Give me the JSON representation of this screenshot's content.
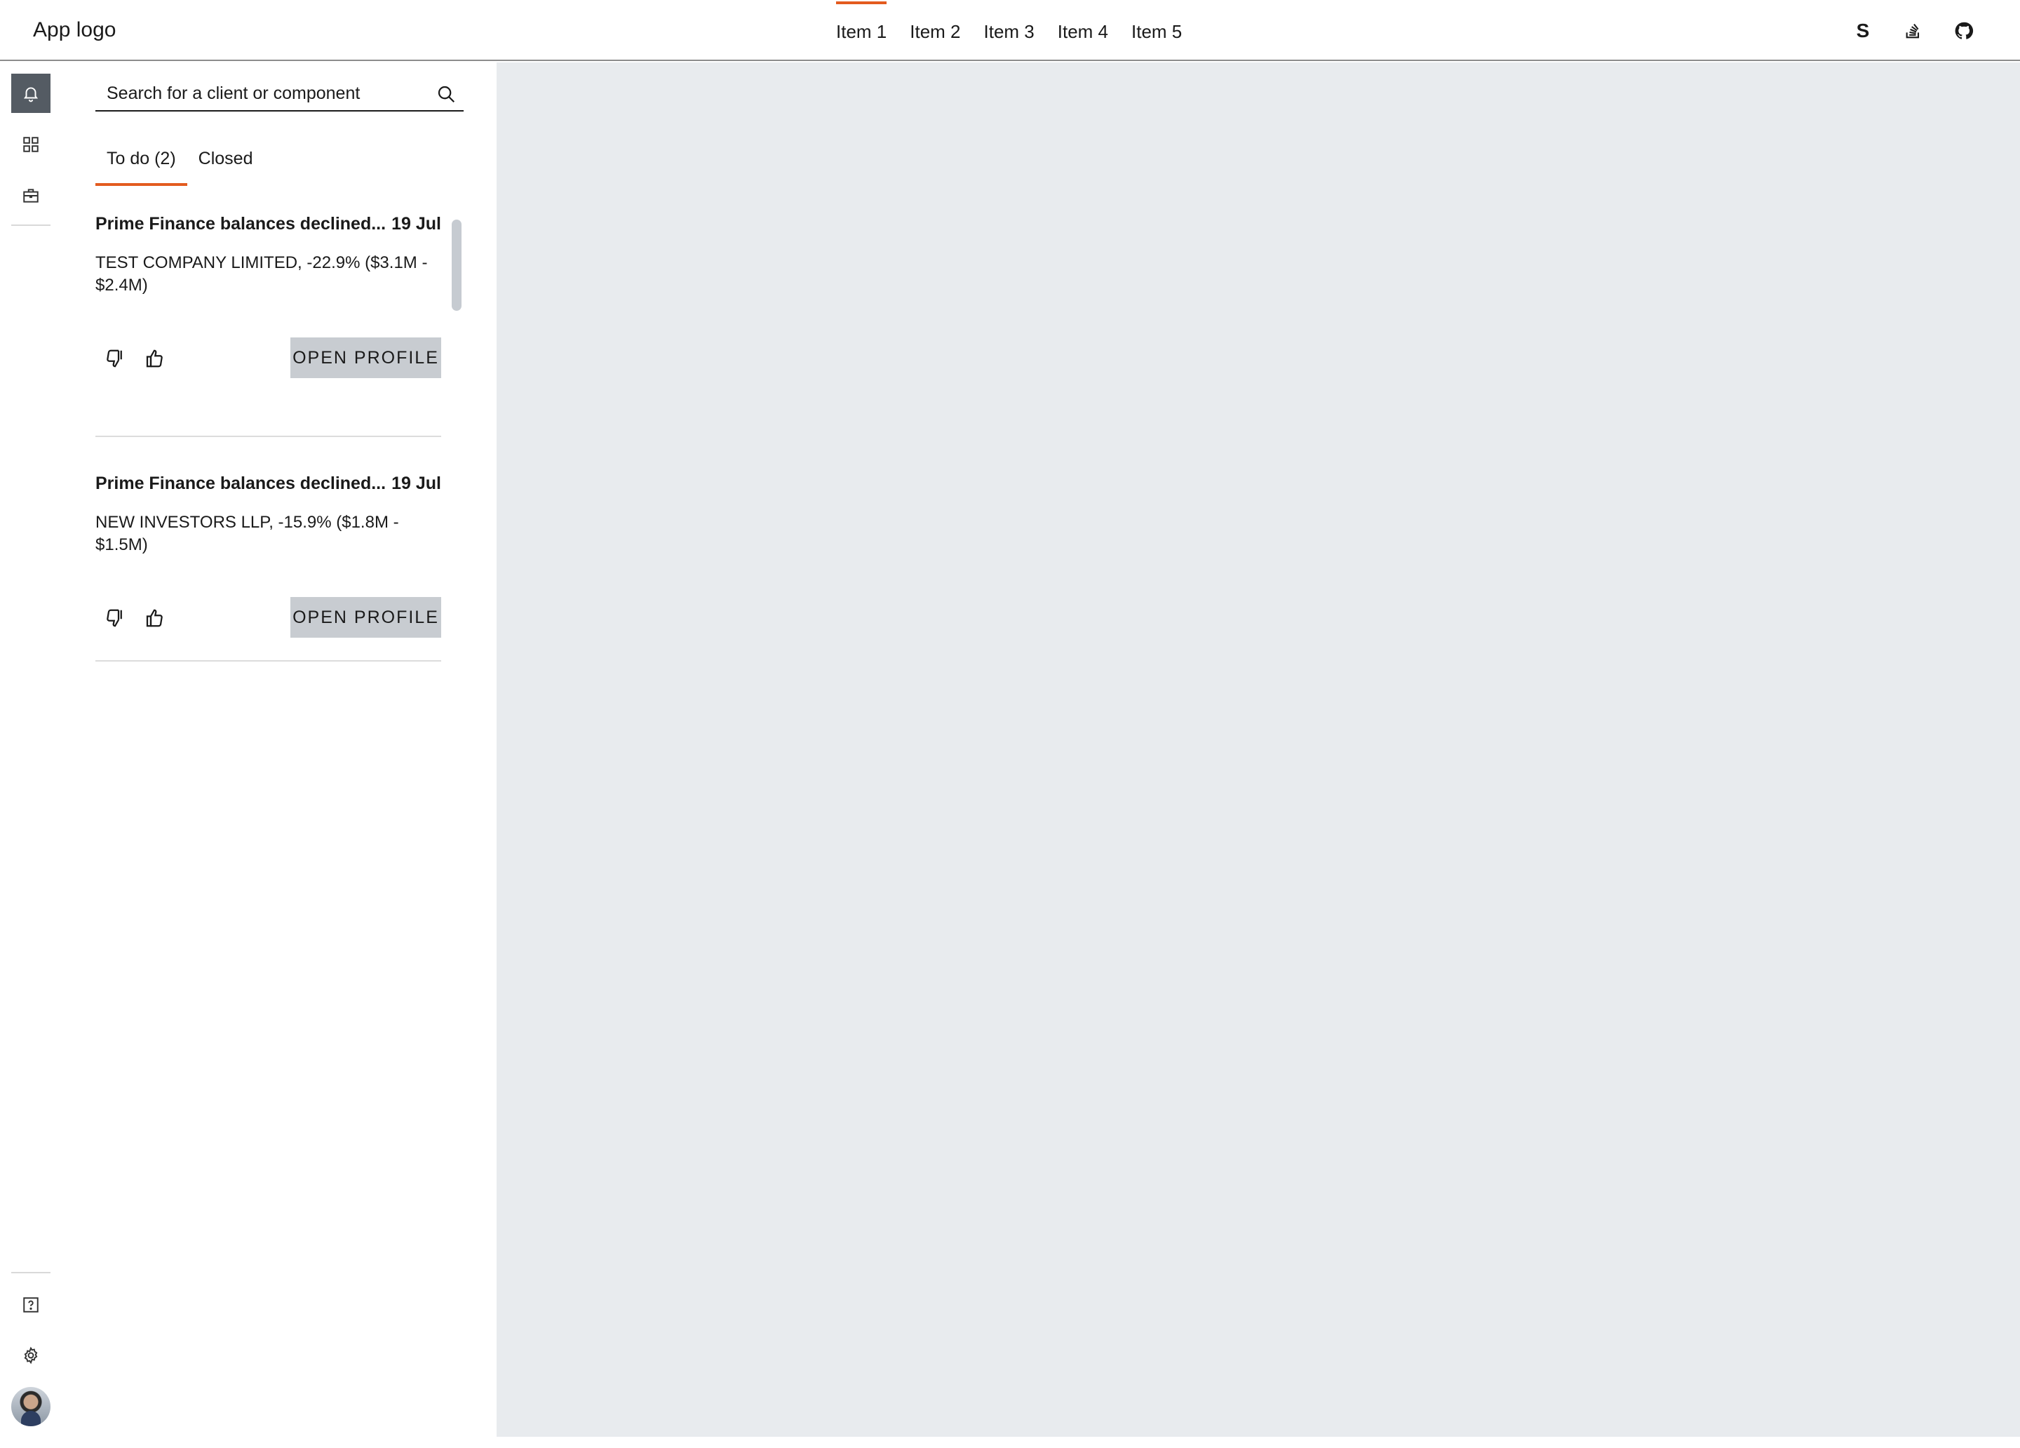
{
  "header": {
    "logo": "App logo",
    "nav": [
      "Item 1",
      "Item 2",
      "Item 3",
      "Item 4",
      "Item 5"
    ],
    "active_nav": "Item 1",
    "icons": {
      "s_letter": "S",
      "stack_icon": "stack-overflow-icon",
      "github_icon": "github-icon"
    }
  },
  "rail": {
    "top_icons": [
      "bell-icon",
      "grid-icon",
      "briefcase-icon"
    ],
    "bottom_icons": [
      "help-icon",
      "gear-icon",
      "avatar"
    ]
  },
  "panel": {
    "search": {
      "placeholder": "Search for a client or component",
      "value": ""
    },
    "tabs": [
      "To do (2)",
      "Closed"
    ],
    "active_tab": "To do (2)",
    "cards": [
      {
        "title": "Prime Finance balances declined...",
        "date": "19 Jul",
        "body": "TEST COMPANY LIMITED, -22.9% ($3.1M - $2.4M)",
        "button": "OPEN PROFILE"
      },
      {
        "title": "Prime Finance balances declined...",
        "date": "19 Jul",
        "body": "NEW INVESTORS LLP, -15.9% ($1.8M - $1.5M)",
        "button": "OPEN PROFILE"
      }
    ]
  },
  "colors": {
    "accent": "#e35b1f",
    "rail_active": "#545b63",
    "content_bg": "#e8ebee",
    "button_bg": "#c8ccd1"
  }
}
